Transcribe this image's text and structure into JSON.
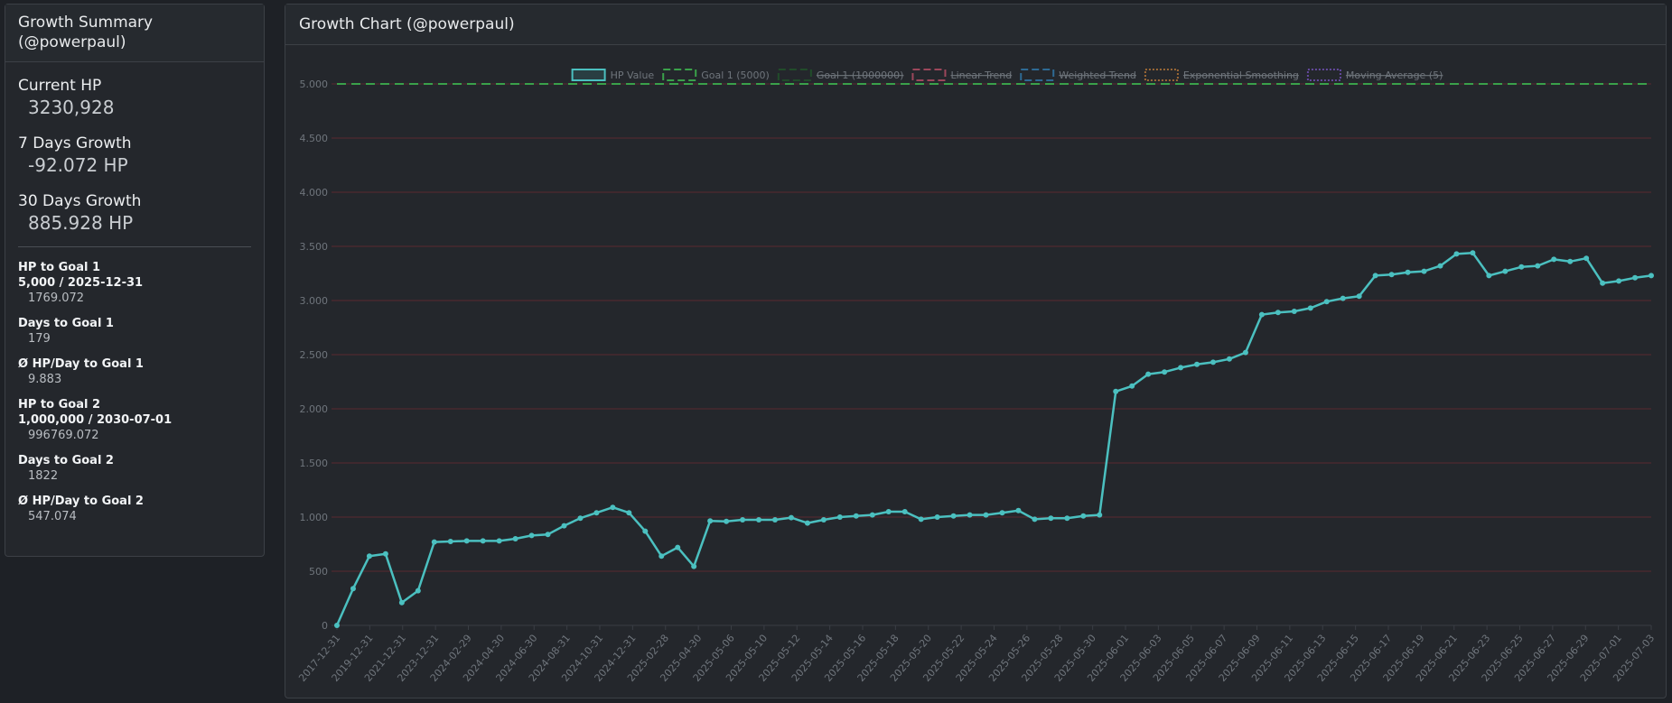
{
  "summary": {
    "title": "Growth Summary (@powerpaul)",
    "current_hp_label": "Current HP",
    "current_hp_value": "3230,928",
    "growth7_label": "7 Days Growth",
    "growth7_value": "-92.072 HP",
    "growth30_label": "30 Days Growth",
    "growth30_value": "885.928 HP",
    "hp_to_goal1_label": "HP to Goal 1",
    "hp_to_goal1_sub": "5,000 / 2025-12-31",
    "hp_to_goal1_value": "1769.072",
    "days_to_goal1_label": "Days to Goal 1",
    "days_to_goal1_value": "179",
    "avg_goal1_label": "Ø HP/Day to Goal 1",
    "avg_goal1_value": "9.883",
    "hp_to_goal2_label": "HP to Goal 2",
    "hp_to_goal2_sub": "1,000,000 / 2030-07-01",
    "hp_to_goal2_value": "996769.072",
    "days_to_goal2_label": "Days to Goal 2",
    "days_to_goal2_value": "1822",
    "avg_goal2_label": "Ø HP/Day to Goal 2",
    "avg_goal2_value": "547.074"
  },
  "chart_panel": {
    "title": "Growth Chart (@powerpaul)"
  },
  "colors": {
    "line": "#4bc0c0",
    "goal1": "#3aa14a",
    "goal2": "#1f6b2a",
    "linear": "#ff6384",
    "weighted": "#36a2eb",
    "exp": "#ff9f40",
    "ma": "#9966ff",
    "grid": "#5a2a30",
    "tick": "#6f757c"
  },
  "chart_data": {
    "type": "line",
    "legend_position": "top",
    "legend": [
      {
        "label": "HP Value",
        "color": "#4bc0c0",
        "style": "solid",
        "hidden": false
      },
      {
        "label": "Goal 1 (5000)",
        "color": "#3aa14a",
        "style": "dashed",
        "hidden": false
      },
      {
        "label": "Goal 1 (1000000)",
        "color": "#1f6b2a",
        "style": "dashed",
        "hidden": true
      },
      {
        "label": "Linear Trend",
        "color": "#ff6384",
        "style": "dashed",
        "hidden": true
      },
      {
        "label": "Weighted Trend",
        "color": "#36a2eb",
        "style": "dashed",
        "hidden": true
      },
      {
        "label": "Exponential Smoothing",
        "color": "#ff9f40",
        "style": "dotted",
        "hidden": true
      },
      {
        "label": "Moving Average (5)",
        "color": "#9966ff",
        "style": "dotted",
        "hidden": true
      }
    ],
    "y_ticks": [
      "0",
      "500",
      "1.000",
      "1.500",
      "2.000",
      "2.500",
      "3.000",
      "3.500",
      "4.000",
      "4.500",
      "5.000"
    ],
    "ylim": [
      0,
      5000
    ],
    "x_tick_labels": [
      "2017-12-31",
      "2019-12-31",
      "2021-12-31",
      "2023-12-31",
      "2024-02-29",
      "2024-04-30",
      "2024-06-30",
      "2024-08-31",
      "2024-10-31",
      "2024-12-31",
      "2025-02-28",
      "2025-04-30",
      "2025-05-06",
      "2025-05-10",
      "2025-05-12",
      "2025-05-14",
      "2025-05-16",
      "2025-05-18",
      "2025-05-20",
      "2025-05-22",
      "2025-05-24",
      "2025-05-26",
      "2025-05-28",
      "2025-05-30",
      "2025-06-01",
      "2025-06-03",
      "2025-06-05",
      "2025-06-07",
      "2025-06-09",
      "2025-06-11",
      "2025-06-13",
      "2025-06-15",
      "2025-06-17",
      "2025-06-19",
      "2025-06-21",
      "2025-06-23",
      "2025-06-25",
      "2025-06-27",
      "2025-06-29",
      "2025-07-01",
      "2025-07-03"
    ],
    "goal1": 5000,
    "series": [
      {
        "name": "HP Value",
        "values": [
          0,
          340,
          640,
          660,
          210,
          320,
          770,
          775,
          780,
          780,
          780,
          800,
          830,
          840,
          920,
          990,
          1040,
          1090,
          1040,
          870,
          640,
          720,
          545,
          965,
          960,
          975,
          975,
          975,
          995,
          945,
          975,
          1000,
          1010,
          1020,
          1050,
          1050,
          980,
          1000,
          1010,
          1020,
          1020,
          1040,
          1060,
          980,
          990,
          990,
          1010,
          1020,
          2160,
          2210,
          2320,
          2340,
          2380,
          2410,
          2430,
          2460,
          2520,
          2870,
          2890,
          2900,
          2930,
          2990,
          3020,
          3040,
          3230,
          3240,
          3260,
          3270,
          3320,
          3430,
          3440,
          3230,
          3270,
          3310,
          3320,
          3380,
          3360,
          3390,
          3160,
          3180,
          3210,
          3230
        ]
      }
    ]
  }
}
